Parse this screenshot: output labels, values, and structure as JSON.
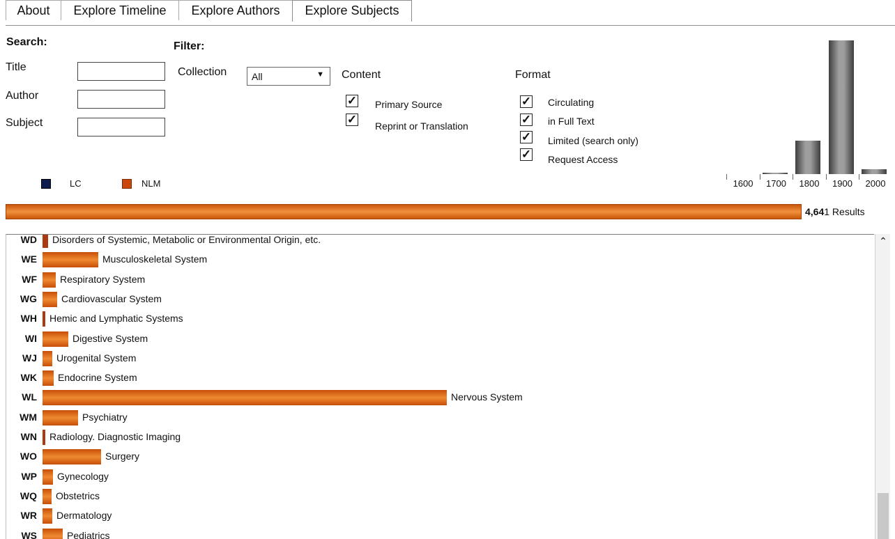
{
  "tabs": [
    "About",
    "Explore Timeline",
    "Explore Authors",
    "Explore Subjects"
  ],
  "active_tab": "Explore Subjects",
  "search": {
    "heading": "Search:",
    "title_label": "Title",
    "author_label": "Author",
    "subject_label": "Subject",
    "title_value": "",
    "author_value": "",
    "subject_value": ""
  },
  "filter": {
    "heading": "Filter:",
    "collection_label": "Collection",
    "collection_value": "All",
    "content_label": "Content",
    "content_options": [
      "Primary Source",
      "Reprint or Translation"
    ],
    "format_label": "Format",
    "format_options": [
      "Circulating",
      "in Full Text",
      "Limited (search only)",
      "Request Access"
    ]
  },
  "legend": {
    "items": [
      {
        "label": "LC",
        "color": "#0d1b4f"
      },
      {
        "label": "NLM",
        "color": "#c9470d"
      }
    ]
  },
  "histogram": {
    "centuries": [
      "1600",
      "1700",
      "1800",
      "1900",
      "2000"
    ],
    "relative_heights": [
      0.0,
      0.01,
      0.25,
      1.0,
      0.035
    ]
  },
  "results": {
    "bold_part": "4,64",
    "rest": "1 Results",
    "fill_fraction": 1.0
  },
  "subjects": [
    {
      "code": "WD",
      "label": "Disorders of Systemic, Metabolic or Environmental Origin, etc.",
      "value": 0.013
    },
    {
      "code": "WE",
      "label": "Musculoskeletal System",
      "value": 0.138
    },
    {
      "code": "WF",
      "label": "Respiratory System",
      "value": 0.033
    },
    {
      "code": "WG",
      "label": "Cardiovascular System",
      "value": 0.036
    },
    {
      "code": "WH",
      "label": "Hemic and Lymphatic Systems",
      "value": 0.005
    },
    {
      "code": "WI",
      "label": "Digestive System",
      "value": 0.064
    },
    {
      "code": "WJ",
      "label": "Urogenital System",
      "value": 0.024
    },
    {
      "code": "WK",
      "label": "Endocrine System",
      "value": 0.028
    },
    {
      "code": "WL",
      "label": "Nervous System",
      "value": 1.0
    },
    {
      "code": "WM",
      "label": "Psychiatry",
      "value": 0.088
    },
    {
      "code": "WN",
      "label": "Radiology. Diagnostic Imaging",
      "value": 0.007
    },
    {
      "code": "WO",
      "label": "Surgery",
      "value": 0.145
    },
    {
      "code": "WP",
      "label": "Gynecology",
      "value": 0.026
    },
    {
      "code": "WQ",
      "label": "Obstetrics",
      "value": 0.022
    },
    {
      "code": "WR",
      "label": "Dermatology",
      "value": 0.024
    },
    {
      "code": "WS",
      "label": "Pediatrics",
      "value": 0.05
    }
  ]
}
